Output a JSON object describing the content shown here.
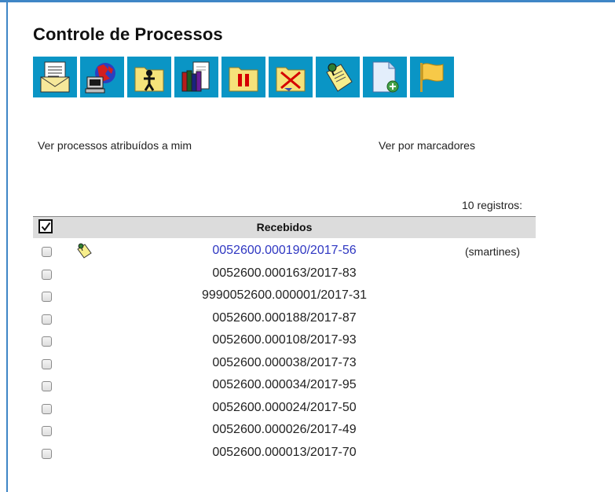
{
  "page": {
    "title": "Controle de Processos"
  },
  "toolbar": {
    "buttons": [
      {
        "icon": "envelope-document-icon"
      },
      {
        "icon": "globe-computer-icon"
      },
      {
        "icon": "person-folder-icon"
      },
      {
        "icon": "books-document-icon"
      },
      {
        "icon": "pause-folder-icon"
      },
      {
        "icon": "folder-cross-icon"
      },
      {
        "icon": "sticky-note-pin-icon"
      },
      {
        "icon": "new-document-icon"
      },
      {
        "icon": "flag-icon"
      }
    ]
  },
  "links": {
    "assigned": "Ver processos atribuídos a mim",
    "markers": "Ver por marcadores"
  },
  "table": {
    "count_label": "10 registros:",
    "header": "Recebidos",
    "header_checked": true,
    "rows": [
      {
        "number": "0052600.000190/2017-56",
        "user": "(smartines)",
        "has_note": true,
        "link_color": "#2f37c2"
      },
      {
        "number": "0052600.000163/2017-83",
        "user": "",
        "has_note": false
      },
      {
        "number": "9990052600.000001/2017-31",
        "user": "",
        "has_note": false
      },
      {
        "number": "0052600.000188/2017-87",
        "user": "",
        "has_note": false
      },
      {
        "number": "0052600.000108/2017-93",
        "user": "",
        "has_note": false
      },
      {
        "number": "0052600.000038/2017-73",
        "user": "",
        "has_note": false
      },
      {
        "number": "0052600.000034/2017-95",
        "user": "",
        "has_note": false
      },
      {
        "number": "0052600.000024/2017-50",
        "user": "",
        "has_note": false
      },
      {
        "number": "0052600.000026/2017-49",
        "user": "",
        "has_note": false
      },
      {
        "number": "0052600.000013/2017-70",
        "user": "",
        "has_note": false
      }
    ]
  },
  "colors": {
    "accent": "#3f86c6",
    "toolbar_bg": "#0a95c5",
    "header_bg": "#dcdcdc"
  }
}
